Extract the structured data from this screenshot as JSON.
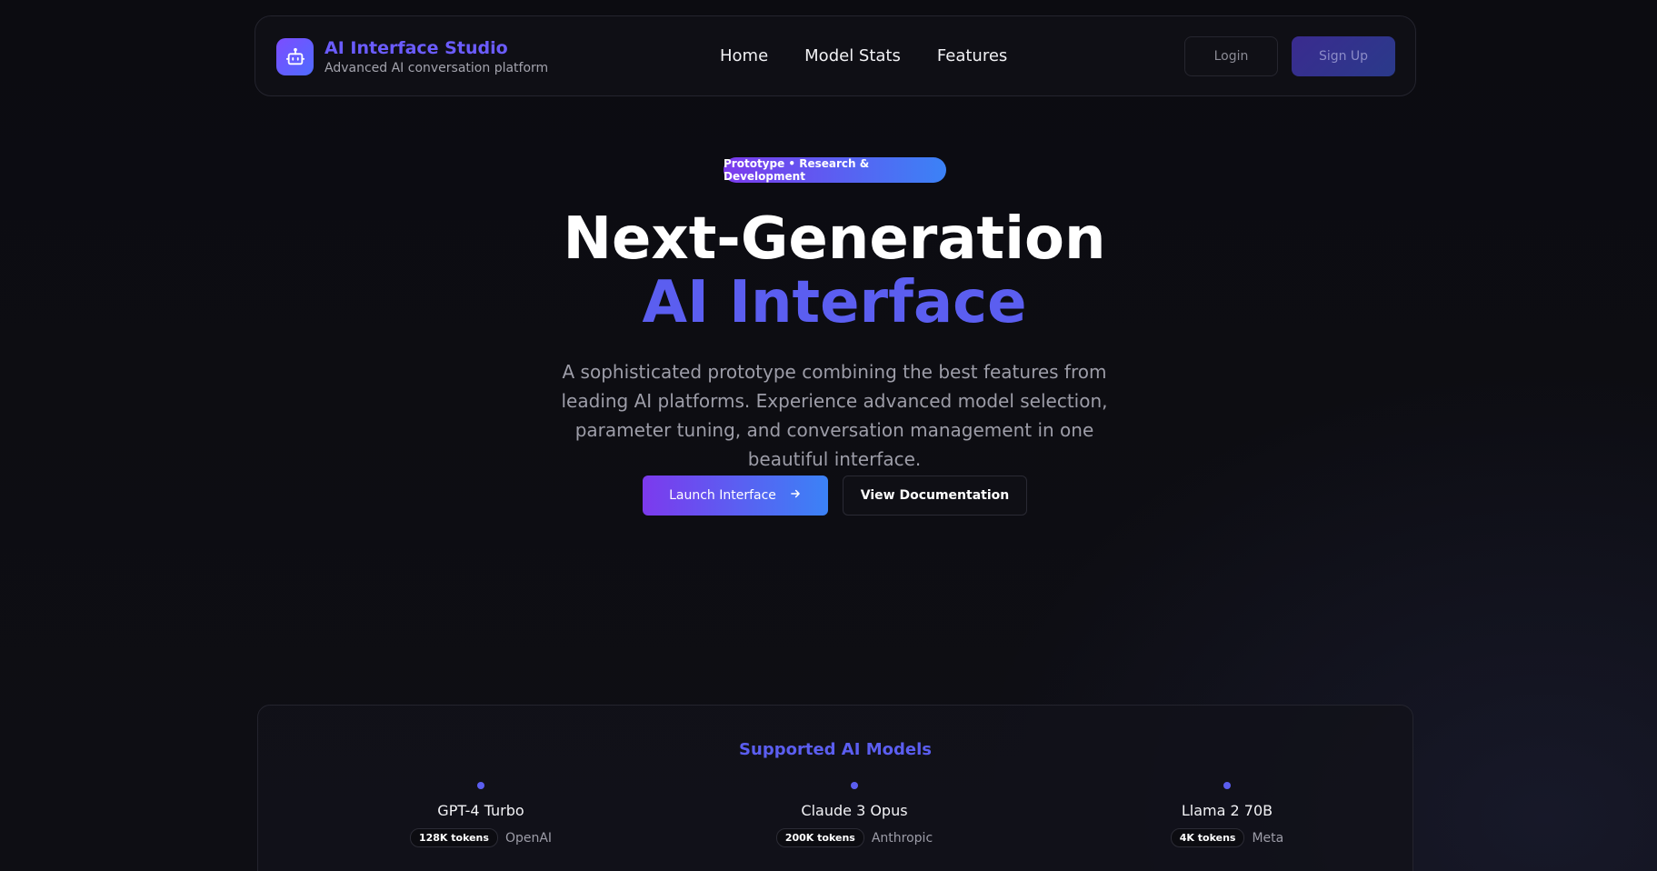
{
  "nav": {
    "brand_title": "AI Interface Studio",
    "brand_subtitle": "Advanced AI conversation platform",
    "links": [
      "Home",
      "Model Stats",
      "Features"
    ],
    "login_label": "Login",
    "signup_label": "Sign Up",
    "logo_icon": "robot-icon"
  },
  "hero": {
    "badge": "Prototype • Research & Development",
    "title_line1": "Next-Generation",
    "title_line2": "AI Interface",
    "description": "A sophisticated prototype combining the best features from leading AI platforms. Experience advanced model selection, parameter tuning, and conversation management in one beautiful interface.",
    "launch_label": "Launch Interface",
    "launch_icon": "arrow-right-icon",
    "docs_label": "View Documentation"
  },
  "models": {
    "title": "Supported AI Models",
    "items": [
      {
        "name": "GPT-4 Turbo",
        "tokens": "128K tokens",
        "vendor": "OpenAI"
      },
      {
        "name": "Claude 3 Opus",
        "tokens": "200K tokens",
        "vendor": "Anthropic"
      },
      {
        "name": "Llama 2 70B",
        "tokens": "4K tokens",
        "vendor": "Meta"
      }
    ]
  },
  "colors": {
    "accent": "#5b5ef0",
    "gradient_start": "#7c3aed",
    "gradient_end": "#3b82f6",
    "background": "#0d0d12"
  }
}
